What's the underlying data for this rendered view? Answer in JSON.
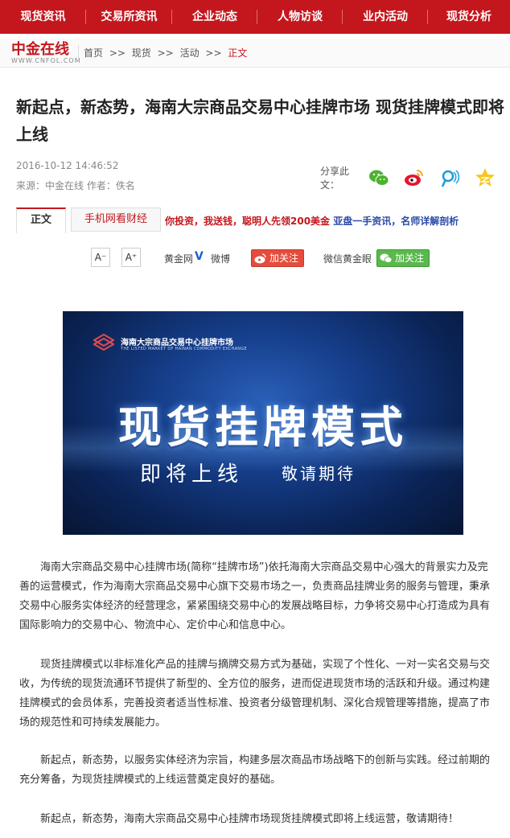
{
  "nav": {
    "items": [
      "现货资讯",
      "交易所资讯",
      "企业动态",
      "人物访谈",
      "业内活动",
      "现货分析"
    ]
  },
  "header": {
    "logo_cn": "中金在线",
    "logo_en": "WWW.CNFOL.COM",
    "breadcrumb": [
      "首页",
      ">>",
      "现货",
      ">>",
      "活动",
      ">>"
    ],
    "breadcrumb_current": "正文"
  },
  "article": {
    "title": "新起点，新态势，海南大宗商品交易中心挂牌市场 现货挂牌模式即将上线",
    "date": "2016-10-12 14:46:52",
    "source_label": "来源：中金在线 作者：佚名"
  },
  "share": {
    "label": "分享此文：",
    "icons": [
      "wechat-icon",
      "weibo-icon",
      "tencent-weibo-icon",
      "qzone-icon"
    ]
  },
  "tabs": {
    "main": "正文",
    "mobile": "手机网看财经"
  },
  "promo": {
    "part1": "你投资，我送钱，聪明人先领200美金",
    "part2": "亚盘一手资讯，名师详解剖析"
  },
  "tools": {
    "font_smaller": "A⁻",
    "font_larger": "A⁺",
    "weibo_account": "黄金网",
    "weibo_v": "V",
    "weibo_label": "微博",
    "weibo_follow": "加关注",
    "wechat_account": "微信黄金眼",
    "wechat_follow": "加关注"
  },
  "banner": {
    "org_name": "海南大宗商品交易中心挂牌市场",
    "org_name_en": "THE LISTED MARKET OF HAINAN COMMODITY EXCHANGE",
    "headline": "现货挂牌模式",
    "sub1": "即将上线",
    "sub2": "敬请期待"
  },
  "body": {
    "p1": "海南大宗商品交易中心挂牌市场(简称“挂牌市场”)依托海南大宗商品交易中心强大的背景实力及完善的运营模式，作为海南大宗商品交易中心旗下交易市场之一，负责商品挂牌业务的服务与管理，秉承交易中心服务实体经济的经营理念，紧紧围绕交易中心的发展战略目标，力争将交易中心打造成为具有国际影响力的交易中心、物流中心、定价中心和信息中心。",
    "p2": "现货挂牌模式以非标准化产品的挂牌与摘牌交易方式为基础，实现了个性化、一对一实名交易与交收，为传统的现货流通环节提供了新型的、全方位的服务，进而促进现货市场的活跃和升级。通过构建挂牌模式的会员体系，完善投资者适当性标准、投资者分级管理机制、深化合规管理等措施，提高了市场的规范性和可持续发展能力。",
    "p3": "新起点，新态势，以服务实体经济为宗旨，构建多层次商品市场战略下的创新与实践。经过前期的充分筹备，为现货挂牌模式的上线运营奠定良好的基础。",
    "p4": "新起点，新态势，海南大宗商品交易中心挂牌市场现货挂牌模式即将上线运营，敬请期待！"
  },
  "colors": {
    "brand_red": "#c4171d",
    "link_blue": "#2a4aa8",
    "banner_blue": "#163f8c"
  }
}
